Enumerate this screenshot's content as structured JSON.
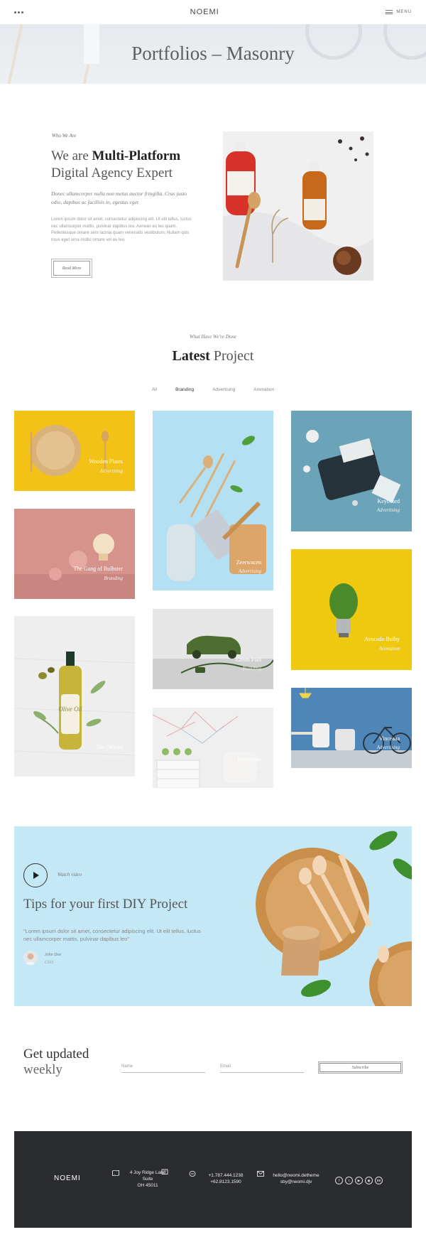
{
  "header": {
    "logo": "NOEMI",
    "menu_label": "MENU"
  },
  "hero": {
    "title": "Portfolios – Masonry"
  },
  "about": {
    "label": "Who We Are",
    "heading_pre": "We are ",
    "heading_bold": "Multi-Platform",
    "heading_line2": "Digital Agency Expert",
    "italic_text": "Donec ullamcorper nulla non metus auctor fringilla. Cras justo odio, dapibus ac facilisis in, egestas eget",
    "body_text": "Lorem ipsum dolor sit amet, consectetur adipiscing elit. Ut elit tellus, luctus nec ullamcorper mattis, pulvinar dapibus leo. Aenean eu leo quam. Pellentesque ornare sem lacinia quam venenatis vestibulum. Nullam quis risus eget urna mollis ornare vel eu leo.",
    "button_label": "Read More"
  },
  "portfolio": {
    "label": "What Have We've Done",
    "heading_bold": "Latest",
    "heading_rest": " Project",
    "filters": [
      "All",
      "Branding",
      "Advertising",
      "Animation"
    ],
    "items": [
      {
        "title": "Wooden Plates",
        "category": "Advertising"
      },
      {
        "title": "The Gang of Bulbster",
        "category": "Branding"
      },
      {
        "title": "The Oilivee",
        "category": "Advertising"
      },
      {
        "title": "Zeerwacen",
        "category": "Advertising"
      },
      {
        "title": "Green Fuel",
        "category": "Branding"
      },
      {
        "title": "Innerroom",
        "category": "Animation"
      },
      {
        "title": "Keyboard",
        "category": "Advertising"
      },
      {
        "title": "Avocado Bulby",
        "category": "Animation"
      },
      {
        "title": "Vinceaaa",
        "category": "Advertising"
      }
    ]
  },
  "video": {
    "watch_label": "Watch video",
    "heading": "Tips for your first DIY Project",
    "quote": "\"Lorem ipsum dolor sit amet, consectetur adipiscing elit. Ut elit tellus, luctus nec ullamcorper mattis, pulvinar dapibus leo\"",
    "author_name": "John Doe",
    "author_role": "CEO",
    "bottle_label": "Olive Oil"
  },
  "newsletter": {
    "heading_line1": "Get updated",
    "heading_line2": "weekly",
    "name_placeholder": "Name",
    "email_placeholder": "Email",
    "button_label": "Subscribe"
  },
  "footer": {
    "logo": "NOEMI",
    "address_line1": "4 Joy Ridge Lane",
    "address_line2": "Suite",
    "address_line3": "OH 45011",
    "phone1": "+1.787.444.1238",
    "phone2": "+62.8123.1590",
    "email1": "hello@neomi.detheme",
    "email2": "sby@neomi.djv",
    "social": [
      "f",
      "t",
      "▶",
      "◉",
      "Bē"
    ]
  },
  "colors": {
    "accent": "#222222",
    "footer_bg": "#2b2c30",
    "video_bg": "#c8e9f6"
  }
}
